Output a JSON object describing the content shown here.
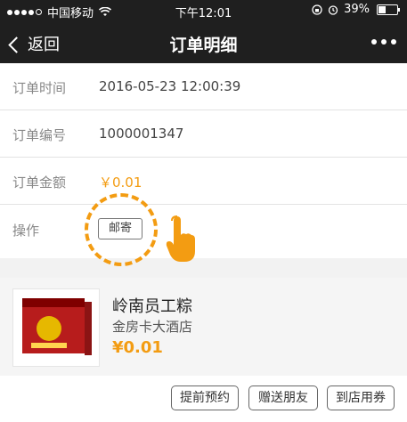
{
  "statusbar": {
    "carrier": "中国移动",
    "time": "下午12:01",
    "battery": "39%",
    "battery_level": 0.39
  },
  "navbar": {
    "back_label": "返回",
    "title": "订单明细"
  },
  "order": {
    "time_label": "订单时间",
    "time_value": "2016-05-23 12:00:39",
    "number_label": "订单编号",
    "number_value": "1000001347",
    "amount_label": "订单金额",
    "amount_value": "￥0.01",
    "action_label": "操作",
    "mail_button": "邮寄"
  },
  "product": {
    "name": "岭南员工粽",
    "shop": "金房卡大酒店",
    "price": "¥0.01"
  },
  "actions": {
    "reserve": "提前预约",
    "gift": "赠送朋友",
    "coupon": "到店用券"
  },
  "colors": {
    "accent": "#f39c12",
    "nav_bg": "#1f1f1f"
  }
}
